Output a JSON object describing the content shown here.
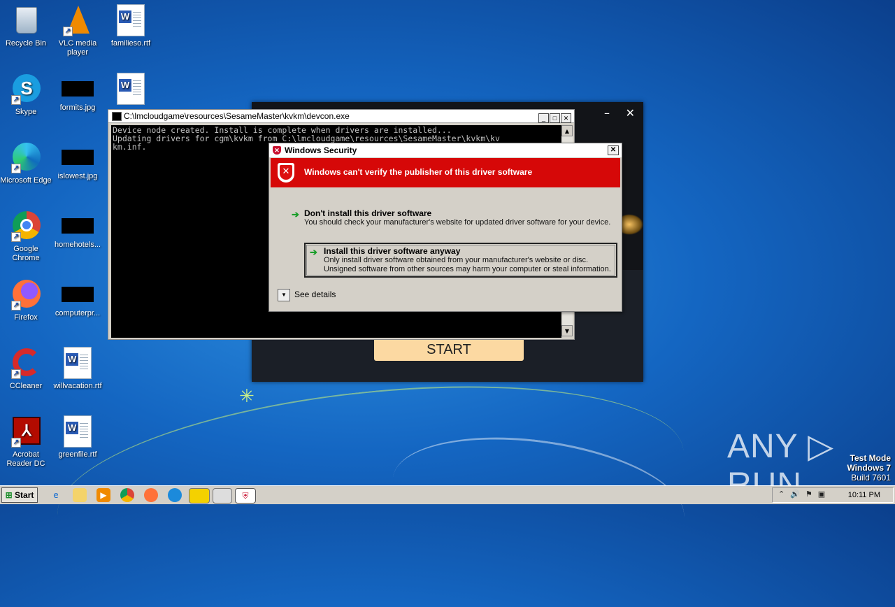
{
  "desktop": {
    "icons": [
      {
        "label": "Recycle Bin"
      },
      {
        "label": "VLC media player"
      },
      {
        "label": "familieso.rtf"
      },
      {
        "label": "Skype"
      },
      {
        "label": "formits.jpg"
      },
      {
        "label": ""
      },
      {
        "label": "Microsoft Edge"
      },
      {
        "label": "islowest.jpg"
      },
      {
        "label": "Google Chrome"
      },
      {
        "label": "homehotels..."
      },
      {
        "label": "Firefox"
      },
      {
        "label": "computerpr..."
      },
      {
        "label": "CCleaner"
      },
      {
        "label": "willvacation.rtf"
      },
      {
        "label": "Acrobat Reader DC"
      },
      {
        "label": "greenfile.rtf"
      }
    ]
  },
  "game_window": {
    "minimize": "–",
    "close": "✕",
    "start_label": "START"
  },
  "console": {
    "title": "C:\\lmcloudgame\\resources\\SesameMaster\\kvkm\\devcon.exe",
    "output": "Device node created. Install is complete when drivers are installed...\nUpdating drivers for cgm\\kvkm from C:\\lmcloudgame\\resources\\SesameMaster\\kvkm\\kv\nkm.inf."
  },
  "security_dialog": {
    "title": "Windows Security",
    "banner": "Windows can't verify the publisher of this driver software",
    "option1_title": "Don't install this driver software",
    "option1_desc": "You should check your manufacturer's website for updated driver software for your device.",
    "option2_title": "Install this driver software anyway",
    "option2_desc": "Only install driver software obtained from your manufacturer's website or disc. Unsigned software from other sources may harm your computer or steal information.",
    "details": "See details"
  },
  "watermark": {
    "brand": "ANY ▷ RUN",
    "mode": "Test Mode",
    "os": "Windows 7",
    "build": "Build 7601"
  },
  "taskbar": {
    "start": "Start",
    "clock": "10:11 PM"
  },
  "colors": {
    "banner_red": "#d60808",
    "start_button": "#fcd9a2"
  }
}
